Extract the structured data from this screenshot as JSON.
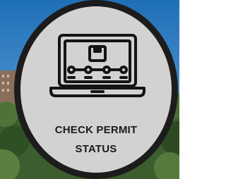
{
  "tile": {
    "line1": "CHECK PERMIT",
    "line2": "STATUS",
    "icon": "laptop-status-tracker-icon",
    "colors": {
      "background": "#d3d2d0",
      "border": "#1c1c1c",
      "text": "#1a1a1a"
    }
  },
  "background": {
    "colors": {
      "sky": "#2e7fc4",
      "trees": "#3c5e2e",
      "building": "#8a6e5c"
    }
  }
}
